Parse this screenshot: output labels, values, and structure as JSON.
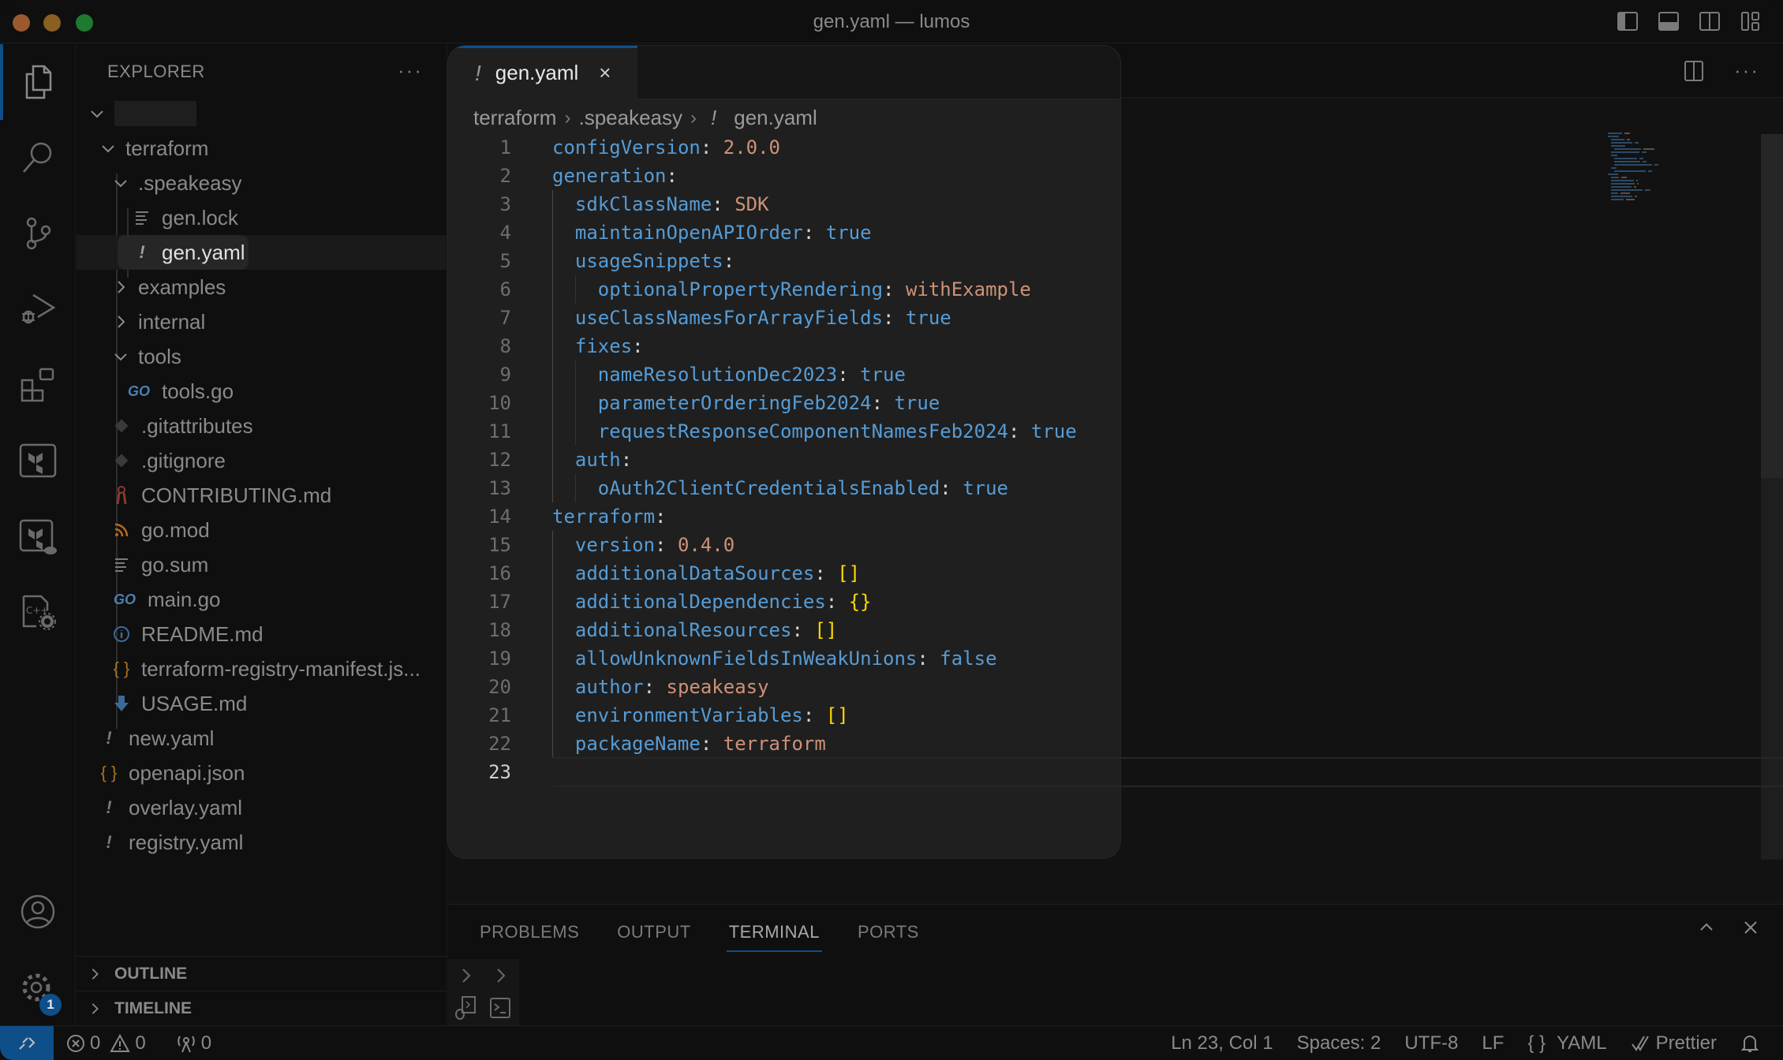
{
  "window": {
    "title": "gen.yaml — lumos",
    "traffic_lights": [
      "close",
      "minimize",
      "zoom"
    ]
  },
  "layout_controls": [
    "toggle-primary-sidebar-icon",
    "toggle-panel-icon",
    "toggle-secondary-sidebar-icon",
    "customize-layout-icon"
  ],
  "activity_bar": {
    "items": [
      {
        "name": "explorer",
        "icon": "files-icon",
        "active": true
      },
      {
        "name": "search",
        "icon": "search-icon"
      },
      {
        "name": "source-control",
        "icon": "source-control-icon"
      },
      {
        "name": "run-and-debug",
        "icon": "run-debug-icon"
      },
      {
        "name": "extensions",
        "icon": "extensions-icon"
      },
      {
        "name": "terraform",
        "icon": "terraform-icon"
      },
      {
        "name": "terraform-cloud",
        "icon": "terraform-cloud-icon"
      },
      {
        "name": "cpp-config",
        "icon": "cpp-settings-icon"
      }
    ],
    "bottom": [
      {
        "name": "accounts",
        "icon": "account-icon"
      },
      {
        "name": "manage",
        "icon": "gear-icon",
        "badge": "1"
      }
    ]
  },
  "sidebar": {
    "title": "EXPLORER",
    "more": "···",
    "tree": [
      {
        "label": "",
        "type": "root-folder",
        "expanded": true,
        "depth": 0,
        "redacted": true
      },
      {
        "label": "terraform",
        "type": "folder",
        "expanded": true,
        "depth": 1
      },
      {
        "label": ".speakeasy",
        "type": "folder",
        "expanded": true,
        "depth": 2
      },
      {
        "label": "gen.lock",
        "type": "file",
        "icon": "lines",
        "depth": 3
      },
      {
        "label": "gen.yaml",
        "type": "file",
        "icon": "yaml",
        "depth": 3,
        "selected": true
      },
      {
        "label": "examples",
        "type": "folder",
        "expanded": false,
        "depth": 2
      },
      {
        "label": "internal",
        "type": "folder",
        "expanded": false,
        "depth": 2
      },
      {
        "label": "tools",
        "type": "folder",
        "expanded": true,
        "depth": 2
      },
      {
        "label": "tools.go",
        "type": "file",
        "icon": "go",
        "depth": 3
      },
      {
        "label": ".gitattributes",
        "type": "file",
        "icon": "git",
        "depth": 2
      },
      {
        "label": ".gitignore",
        "type": "file",
        "icon": "git",
        "depth": 2
      },
      {
        "label": "CONTRIBUTING.md",
        "type": "file",
        "icon": "contributing",
        "depth": 2
      },
      {
        "label": "go.mod",
        "type": "file",
        "icon": "gomod",
        "depth": 2
      },
      {
        "label": "go.sum",
        "type": "file",
        "icon": "lines",
        "depth": 2
      },
      {
        "label": "main.go",
        "type": "file",
        "icon": "go",
        "depth": 2
      },
      {
        "label": "README.md",
        "type": "file",
        "icon": "info",
        "depth": 2
      },
      {
        "label": "terraform-registry-manifest.js...",
        "type": "file",
        "icon": "json",
        "depth": 2
      },
      {
        "label": "USAGE.md",
        "type": "file",
        "icon": "download",
        "depth": 2
      },
      {
        "label": "new.yaml",
        "type": "file",
        "icon": "yaml",
        "depth": 1
      },
      {
        "label": "openapi.json",
        "type": "file",
        "icon": "json",
        "depth": 1
      },
      {
        "label": "overlay.yaml",
        "type": "file",
        "icon": "yaml",
        "depth": 1
      },
      {
        "label": "registry.yaml",
        "type": "file",
        "icon": "yaml",
        "depth": 1
      }
    ],
    "sections": [
      {
        "label": "OUTLINE",
        "expanded": false
      },
      {
        "label": "TIMELINE",
        "expanded": false
      }
    ]
  },
  "editor": {
    "tab": {
      "label": "gen.yaml",
      "icon": "!",
      "close": "×"
    },
    "breadcrumb": [
      "terraform",
      ".speakeasy",
      "gen.yaml"
    ],
    "breadcrumb_file_icon": "!",
    "current_line": 23,
    "lines": [
      {
        "n": "1",
        "indent": 0,
        "key": "configVersion",
        "value": "2.0.0",
        "vtype": "s"
      },
      {
        "n": "2",
        "indent": 0,
        "key": "generation",
        "value": "",
        "vtype": ""
      },
      {
        "n": "3",
        "indent": 1,
        "key": "sdkClassName",
        "value": "SDK",
        "vtype": "s"
      },
      {
        "n": "4",
        "indent": 1,
        "key": "maintainOpenAPIOrder",
        "value": "true",
        "vtype": "b"
      },
      {
        "n": "5",
        "indent": 1,
        "key": "usageSnippets",
        "value": "",
        "vtype": ""
      },
      {
        "n": "6",
        "indent": 2,
        "key": "optionalPropertyRendering",
        "value": "withExample",
        "vtype": "s"
      },
      {
        "n": "7",
        "indent": 1,
        "key": "useClassNamesForArrayFields",
        "value": "true",
        "vtype": "b"
      },
      {
        "n": "8",
        "indent": 1,
        "key": "fixes",
        "value": "",
        "vtype": ""
      },
      {
        "n": "9",
        "indent": 2,
        "key": "nameResolutionDec2023",
        "value": "true",
        "vtype": "b"
      },
      {
        "n": "10",
        "indent": 2,
        "key": "parameterOrderingFeb2024",
        "value": "true",
        "vtype": "b"
      },
      {
        "n": "11",
        "indent": 2,
        "key": "requestResponseComponentNamesFeb2024",
        "value": "true",
        "vtype": "b"
      },
      {
        "n": "12",
        "indent": 1,
        "key": "auth",
        "value": "",
        "vtype": ""
      },
      {
        "n": "13",
        "indent": 2,
        "key": "oAuth2ClientCredentialsEnabled",
        "value": "true",
        "vtype": "b"
      },
      {
        "n": "14",
        "indent": 0,
        "key": "terraform",
        "value": "",
        "vtype": ""
      },
      {
        "n": "15",
        "indent": 1,
        "key": "version",
        "value": "0.4.0",
        "vtype": "s"
      },
      {
        "n": "16",
        "indent": 1,
        "key": "additionalDataSources",
        "value": "[]",
        "vtype": "br"
      },
      {
        "n": "17",
        "indent": 1,
        "key": "additionalDependencies",
        "value": "{}",
        "vtype": "br"
      },
      {
        "n": "18",
        "indent": 1,
        "key": "additionalResources",
        "value": "[]",
        "vtype": "br"
      },
      {
        "n": "19",
        "indent": 1,
        "key": "allowUnknownFieldsInWeakUnions",
        "value": "false",
        "vtype": "b"
      },
      {
        "n": "20",
        "indent": 1,
        "key": "author",
        "value": "speakeasy",
        "vtype": "s"
      },
      {
        "n": "21",
        "indent": 1,
        "key": "environmentVariables",
        "value": "[]",
        "vtype": "br"
      },
      {
        "n": "22",
        "indent": 1,
        "key": "packageName",
        "value": "terraform",
        "vtype": "s"
      },
      {
        "n": "23",
        "indent": 0,
        "key": "",
        "value": "",
        "vtype": ""
      }
    ],
    "actions": [
      "split-editor-icon",
      "more-actions-icon"
    ]
  },
  "panel": {
    "tabs": [
      {
        "label": "PROBLEMS"
      },
      {
        "label": "OUTPUT"
      },
      {
        "label": "TERMINAL",
        "active": true
      },
      {
        "label": "PORTS"
      }
    ],
    "actions": [
      "maximize-panel-icon",
      "close-panel-icon"
    ]
  },
  "statusbar": {
    "errors": "0",
    "warnings": "0",
    "ports": "0",
    "cursor": "Ln 23, Col 1",
    "spaces": "Spaces: 2",
    "encoding": "UTF-8",
    "eol": "LF",
    "language": "YAML",
    "formatter": "Prettier"
  },
  "colors": {
    "accent": "#0e4f8a",
    "key": "#569cd6",
    "string": "#ce9178",
    "bracket": "#ffd700",
    "punct": "#d4d4d4"
  }
}
